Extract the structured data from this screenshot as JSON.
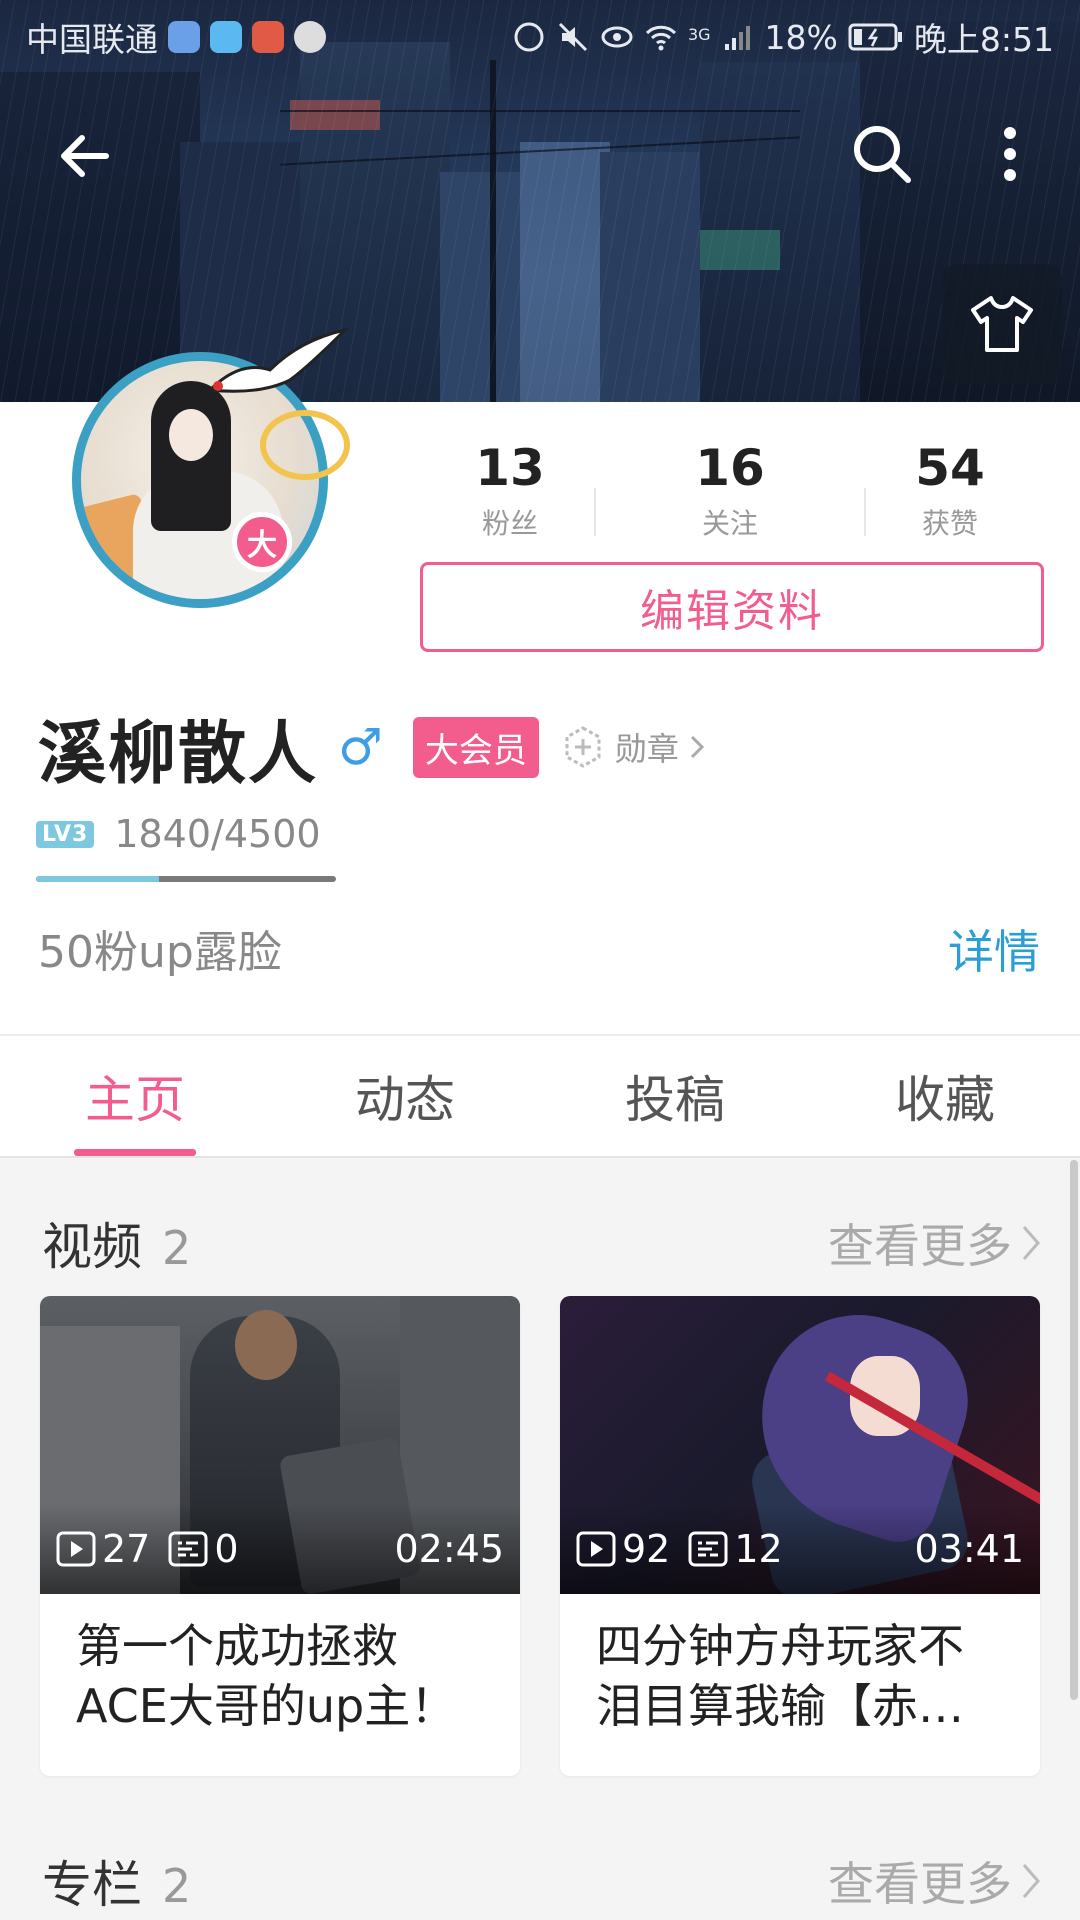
{
  "status_bar": {
    "carrier": "中国联通",
    "network": "3G",
    "battery": "18%",
    "time": "晚上8:51"
  },
  "profile": {
    "stats": [
      {
        "value": "13",
        "label": "粉丝"
      },
      {
        "value": "16",
        "label": "关注"
      },
      {
        "value": "54",
        "label": "获赞"
      }
    ],
    "edit_button": "编辑资料",
    "avatar_badge": "大",
    "username": "溪柳散人",
    "gender_symbol": "♂",
    "vip_tag": "大会员",
    "medal_label": "勋章",
    "level_badge": "LV3",
    "exp_text": "1840/4500",
    "exp_fraction": 0.409,
    "bio": "50粉up露脸",
    "detail_link": "详情"
  },
  "tabs": [
    "主页",
    "动态",
    "投稿",
    "收藏"
  ],
  "videos_section": {
    "title": "视频",
    "count": "2",
    "more": "查看更多"
  },
  "videos": [
    {
      "plays": "27",
      "danmaku": "0",
      "duration": "02:45",
      "title": "第一个成功拯救ACE大哥的up主！"
    },
    {
      "plays": "92",
      "danmaku": "12",
      "duration": "03:41",
      "title": "四分钟方舟玩家不泪目算我输【赤…"
    }
  ],
  "articles_section": {
    "title": "专栏",
    "count": "2",
    "more": "查看更多"
  },
  "colors": {
    "accent": "#f25d8e",
    "link": "#2a9fd6",
    "gender": "#3d9ee6",
    "level": "#7ec7e0"
  }
}
